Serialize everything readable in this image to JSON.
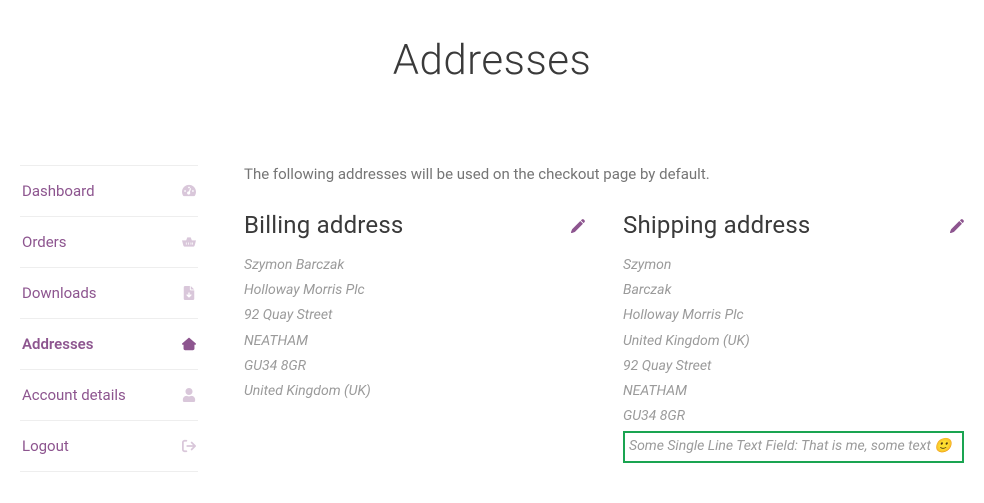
{
  "page": {
    "title": "Addresses",
    "intro": "The following addresses will be used on the checkout page by default."
  },
  "sidebar": {
    "items": [
      {
        "label": "Dashboard",
        "icon": "dashboard-icon",
        "active": false
      },
      {
        "label": "Orders",
        "icon": "basket-icon",
        "active": false
      },
      {
        "label": "Downloads",
        "icon": "file-icon",
        "active": false
      },
      {
        "label": "Addresses",
        "icon": "home-icon",
        "active": true
      },
      {
        "label": "Account details",
        "icon": "user-icon",
        "active": false
      },
      {
        "label": "Logout",
        "icon": "logout-icon",
        "active": false
      }
    ]
  },
  "columns": {
    "billing": {
      "heading": "Billing address",
      "lines": [
        "Szymon Barczak",
        "Holloway Morris Plc",
        "92 Quay Street",
        "NEATHAM",
        "GU34 8GR",
        "United Kingdom (UK)"
      ]
    },
    "shipping": {
      "heading": "Shipping address",
      "lines": [
        "Szymon",
        "Barczak",
        "Holloway Morris Plc",
        "United Kingdom (UK)",
        "92 Quay Street",
        "NEATHAM",
        "GU34 8GR"
      ],
      "highlight_line": "Some Single Line Text Field: That is me, some text 🙂"
    }
  }
}
